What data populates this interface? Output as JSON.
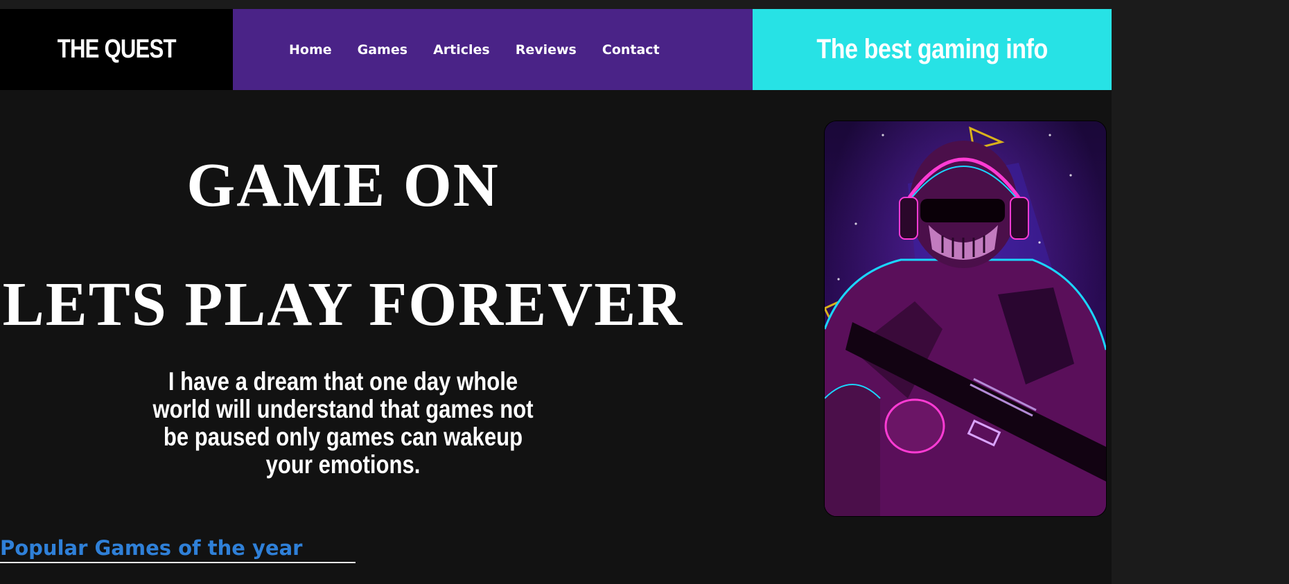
{
  "brand": {
    "logo_text": "THE QUEST"
  },
  "nav": {
    "items": [
      {
        "label": "Home"
      },
      {
        "label": "Games"
      },
      {
        "label": "Articles"
      },
      {
        "label": "Reviews"
      },
      {
        "label": "Contact"
      }
    ]
  },
  "header": {
    "tagline": "The best gaming info"
  },
  "hero": {
    "title_line1": "GAME ON",
    "title_line2": "LETS PLAY FOREVER",
    "paragraph": "I have a dream that one day whole world will understand that games not be paused only games can wakeup your emotions."
  },
  "section": {
    "heading": "Popular Games of the year"
  },
  "colors": {
    "nav_bg": "#4a2387",
    "tagline_bg": "#27e2e5",
    "page_bg": "#121212",
    "link_blue": "#2f80d8"
  },
  "icons": {
    "poster": "neon-soldier-poster"
  }
}
